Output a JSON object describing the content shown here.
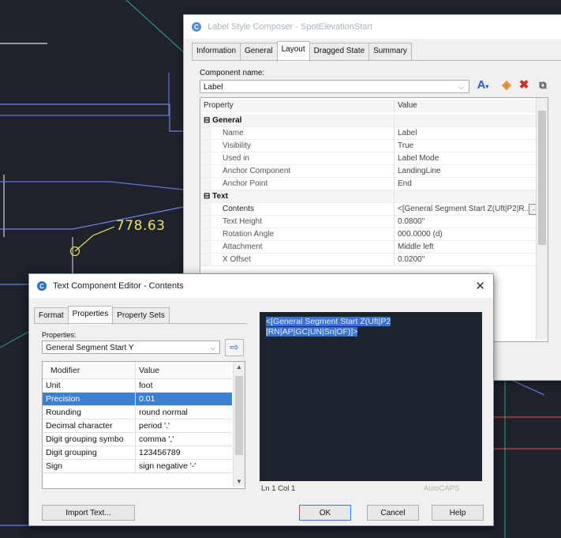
{
  "cad": {
    "spot_value": "778.63"
  },
  "label_style_composer": {
    "title": "Label Style Composer - SpotElevationStart",
    "tabs": [
      "Information",
      "General",
      "Layout",
      "Dragged State",
      "Summary"
    ],
    "active_tab": "Layout",
    "component_name_label": "Component name:",
    "component_name_value": "Label",
    "toolbar_icons": [
      "text-style-icon",
      "color-icon",
      "delete-icon",
      "copy-icon"
    ],
    "grid_headers": {
      "property": "Property",
      "value": "Value"
    },
    "rows": [
      {
        "type": "cat",
        "name": "General",
        "value": ""
      },
      {
        "type": "sub",
        "name": "Name",
        "value": "Label"
      },
      {
        "type": "sub",
        "name": "Visibility",
        "value": "True"
      },
      {
        "type": "sub",
        "name": "Used in",
        "value": "Label Mode"
      },
      {
        "type": "sub",
        "name": "Anchor Component",
        "value": "LandingLine"
      },
      {
        "type": "sub",
        "name": "Anchor Point",
        "value": "End"
      },
      {
        "type": "cat",
        "name": "Text",
        "value": ""
      },
      {
        "type": "sub",
        "name": "Contents",
        "value": "<[General Segment Start Z(Uft|P2|R..."
      },
      {
        "type": "sub",
        "name": "Text Height",
        "value": "0.0800\""
      },
      {
        "type": "sub",
        "name": "Rotation Angle",
        "value": "000.0000 (d)"
      },
      {
        "type": "sub",
        "name": "Attachment",
        "value": "Middle left"
      },
      {
        "type": "sub",
        "name": "X Offset",
        "value": "0.0200\""
      }
    ]
  },
  "text_component_editor": {
    "title": "Text Component Editor - Contents",
    "close_glyph": "✕",
    "tabs": [
      "Format",
      "Properties",
      "Property Sets"
    ],
    "active_tab": "Properties",
    "properties_label": "Properties:",
    "properties_value": "General Segment Start Y",
    "modifier_headers": {
      "modifier": "Modifier",
      "value": "Value"
    },
    "modifiers": [
      {
        "name": "Unit",
        "value": "foot",
        "selected": false
      },
      {
        "name": "Precision",
        "value": "0.01",
        "selected": true
      },
      {
        "name": "Rounding",
        "value": "round normal",
        "selected": false
      },
      {
        "name": "Decimal character",
        "value": "period '.'",
        "selected": false
      },
      {
        "name": "Digit grouping symbo",
        "value": "comma ','",
        "selected": false
      },
      {
        "name": "Digit grouping",
        "value": "123456789",
        "selected": false
      },
      {
        "name": "Sign",
        "value": "sign negative '-'",
        "selected": false
      }
    ],
    "editor_text_line1": "<[General Segment Start Z(Uft|P2",
    "editor_text_line2": "|RN|AP|GC|UN|Sn|OF)]>",
    "status_position": "Ln 1 Col 1",
    "status_brand": "AutoCAPS",
    "buttons": {
      "import": "Import Text...",
      "ok": "OK",
      "cancel": "Cancel",
      "help": "Help"
    }
  }
}
